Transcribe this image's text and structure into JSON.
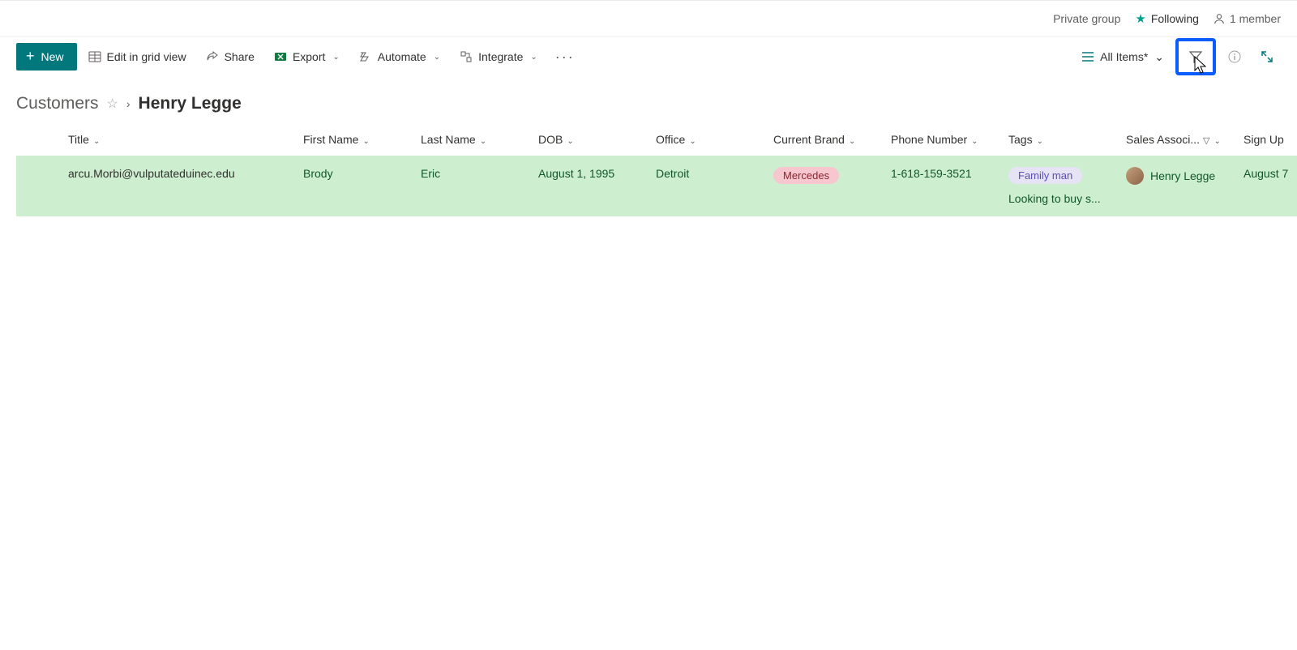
{
  "top": {
    "private_group": "Private group",
    "following": "Following",
    "member_count": "1 member"
  },
  "cmdbar": {
    "new": "New",
    "edit_grid": "Edit in grid view",
    "share": "Share",
    "export": "Export",
    "automate": "Automate",
    "integrate": "Integrate",
    "view": "All Items*"
  },
  "breadcrumb": {
    "root": "Customers",
    "leaf": "Henry Legge"
  },
  "columns": {
    "title": "Title",
    "first": "First Name",
    "last": "Last Name",
    "dob": "DOB",
    "office": "Office",
    "brand": "Current Brand",
    "phone": "Phone Number",
    "tags": "Tags",
    "assoc": "Sales Associ...",
    "signup": "Sign Up"
  },
  "row": {
    "title": "arcu.Morbi@vulputateduinec.edu",
    "first": "Brody",
    "last": "Eric",
    "dob": "August 1, 1995",
    "office": "Detroit",
    "brand": "Mercedes",
    "phone": "1-618-159-3521",
    "tag1": "Family man",
    "tag2": "Looking to buy s...",
    "assoc": "Henry Legge",
    "signup": "August 7"
  }
}
